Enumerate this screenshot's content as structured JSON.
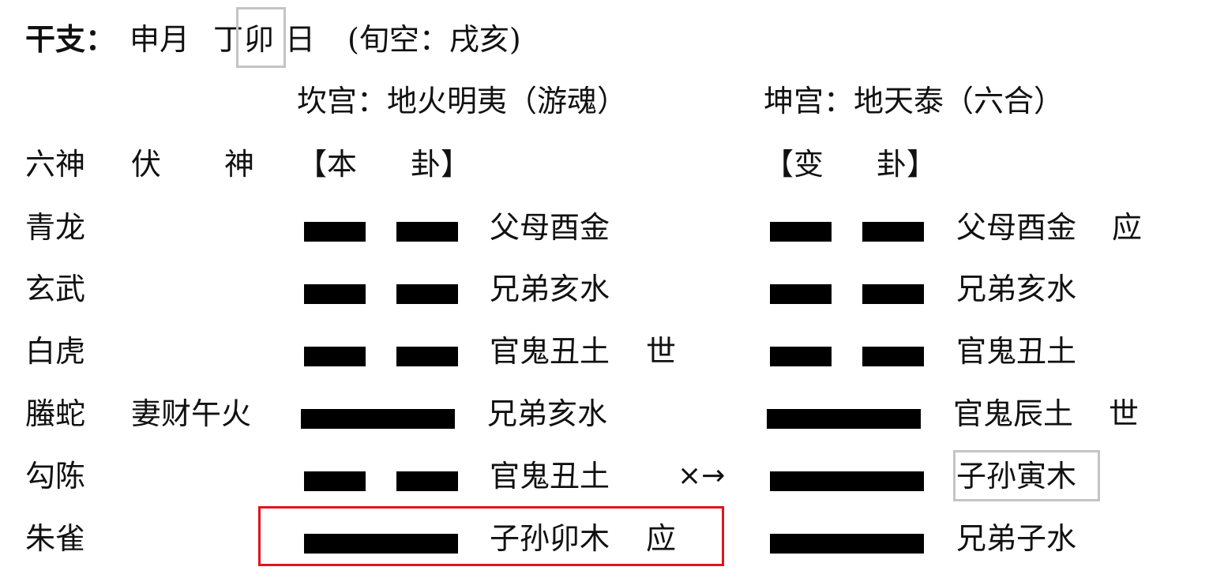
{
  "header": {
    "label": "干支：",
    "month": "申月",
    "day_stem": "丁",
    "day_branch": "卯",
    "day_suffix": "日",
    "void": "(旬空：戌亥)"
  },
  "original_hexagram": {
    "palace_title": "坎宫：地火明夷（游魂）",
    "column_label_left": "【本",
    "column_label_right": "卦】"
  },
  "changed_hexagram": {
    "palace_title": "坤宫：地天泰（六合）",
    "column_label_left": "【变",
    "column_label_right": "卦】"
  },
  "columns": {
    "six_spirits": "六神",
    "hidden_spirit_a": "伏",
    "hidden_spirit_b": "神"
  },
  "lines": [
    {
      "spirit": "青龙",
      "hidden": "",
      "orig_line": "yin",
      "orig_relation": "父母酉金",
      "orig_mark": "",
      "moving": "",
      "chg_line": "yin",
      "chg_relation": "父母酉金",
      "chg_mark": "应"
    },
    {
      "spirit": "玄武",
      "hidden": "",
      "orig_line": "yin",
      "orig_relation": "兄弟亥水",
      "orig_mark": "",
      "moving": "",
      "chg_line": "yin",
      "chg_relation": "兄弟亥水",
      "chg_mark": ""
    },
    {
      "spirit": "白虎",
      "hidden": "",
      "orig_line": "yin",
      "orig_relation": "官鬼丑土",
      "orig_mark": "世",
      "moving": "",
      "chg_line": "yin",
      "chg_relation": "官鬼丑土",
      "chg_mark": ""
    },
    {
      "spirit": "螣蛇",
      "hidden": "妻财午火",
      "orig_line": "yang",
      "orig_relation": "兄弟亥水",
      "orig_mark": "",
      "moving": "",
      "chg_line": "yang",
      "chg_relation": "官鬼辰土",
      "chg_mark": "世"
    },
    {
      "spirit": "勾陈",
      "hidden": "",
      "orig_line": "yin",
      "orig_relation": "官鬼丑土",
      "orig_mark": "",
      "moving": "×→",
      "chg_line": "yang",
      "chg_relation": "子孙寅木",
      "chg_mark": ""
    },
    {
      "spirit": "朱雀",
      "hidden": "",
      "orig_line": "yang",
      "orig_relation": "子孙卯木",
      "orig_mark": "应",
      "moving": "",
      "chg_line": "yang",
      "chg_relation": "兄弟子水",
      "chg_mark": ""
    }
  ],
  "colors": {
    "ink": "#000000",
    "highlight_gray": "#c4c4c4",
    "highlight_red": "#e0141e"
  }
}
